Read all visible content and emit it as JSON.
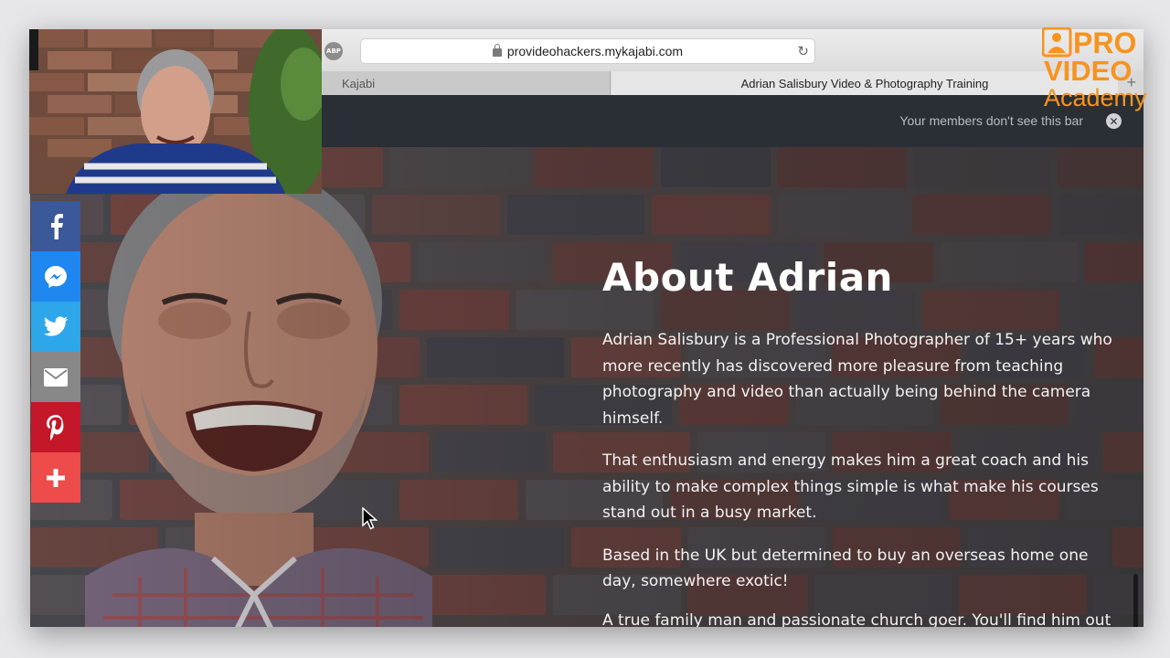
{
  "browser": {
    "url": "provideohackers.mykajabi.com",
    "adblock_label": "ABP",
    "tabs": [
      {
        "label": "Kajabi",
        "active": false
      },
      {
        "label": "Adrian Salisbury Video & Photography Training",
        "active": true
      }
    ]
  },
  "admin_bar": {
    "text": "Your members don't see this bar"
  },
  "about": {
    "heading": "About Adrian",
    "paragraphs": [
      "Adrian Salisbury is a Professional Photographer of 15+ years who more recently has discovered more pleasure from teaching photography and video than actually being behind the camera himself.",
      "That enthusiasm and energy makes him a great coach and his ability to make complex things simple is what make his courses stand out in a busy market.",
      "Based in the UK but determined to buy an overseas home one day, somewhere exotic!",
      "A true family man and passionate church goer. You'll find him out"
    ]
  },
  "share_bar": {
    "buttons": [
      {
        "name": "facebook",
        "color": "#3b5998"
      },
      {
        "name": "messenger",
        "color": "#1e88f0"
      },
      {
        "name": "twitter",
        "color": "#2ea6ea"
      },
      {
        "name": "email",
        "color": "#888888"
      },
      {
        "name": "pinterest",
        "color": "#c4172a"
      },
      {
        "name": "more",
        "color": "#ee4b4b"
      }
    ]
  },
  "logo": {
    "line1": "PRO",
    "line2": "VIDEO",
    "line3": "Academy",
    "color": "#f7931e"
  }
}
